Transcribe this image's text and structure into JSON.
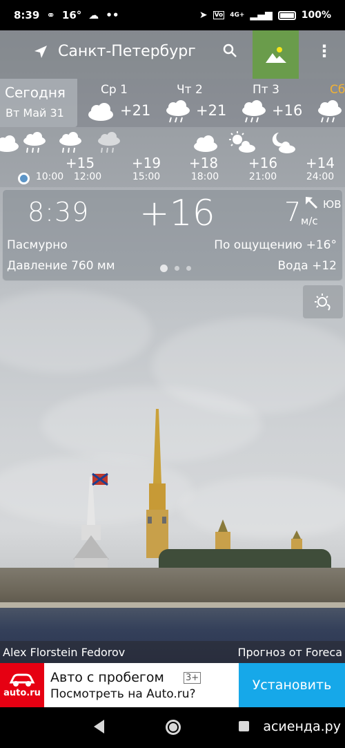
{
  "statusbar": {
    "time": "8:39",
    "temp": "16",
    "signal": "4G+",
    "battery": "100%"
  },
  "header": {
    "city": "Санкт-Петербург"
  },
  "days": {
    "today": {
      "label": "Сегодня",
      "date": "Вт Май 31"
    },
    "items": [
      {
        "name": "Ср 1",
        "temp": "+21",
        "icon": "cloud-rain-icon"
      },
      {
        "name": "Чт 2",
        "temp": "+21",
        "icon": "cloud-rain-icon"
      },
      {
        "name": "Пт 3",
        "temp": "+16",
        "icon": "cloud-rain-icon"
      },
      {
        "name": "Сб",
        "temp": "",
        "icon": "cloud-rain-icon"
      }
    ]
  },
  "hours": [
    {
      "time": "10:00",
      "temp": ""
    },
    {
      "time": "12:00",
      "temp": "+15"
    },
    {
      "time": "15:00",
      "temp": "+19"
    },
    {
      "time": "18:00",
      "temp": "+18"
    },
    {
      "time": "21:00",
      "temp": "+16"
    },
    {
      "time": "24:00",
      "temp": "+14"
    }
  ],
  "current": {
    "time": "8:39",
    "temp": "+16",
    "wind_speed": "7",
    "wind_unit": "м/с",
    "wind_dir": "ЮВ",
    "condition": "Пасмурно",
    "feels_like": "По ощущению +16°",
    "pressure": "Давление 760 мм",
    "water": "Вода +12"
  },
  "credit": {
    "author": "Alex Florstein Fedorov",
    "provider": "Прогноз от Foreca"
  },
  "ad": {
    "logo": "auto.ru",
    "title": "Авто с пробегом",
    "age": "3+",
    "subtitle": "Посмотреть на Auto.ru?",
    "button": "Установить"
  },
  "watermark": "асиенда.ру",
  "colors": {
    "accent_green": "#6a9c4b",
    "install_blue": "#16a8e9",
    "ad_red": "#e60012",
    "sat_orange": "#f2b233"
  }
}
